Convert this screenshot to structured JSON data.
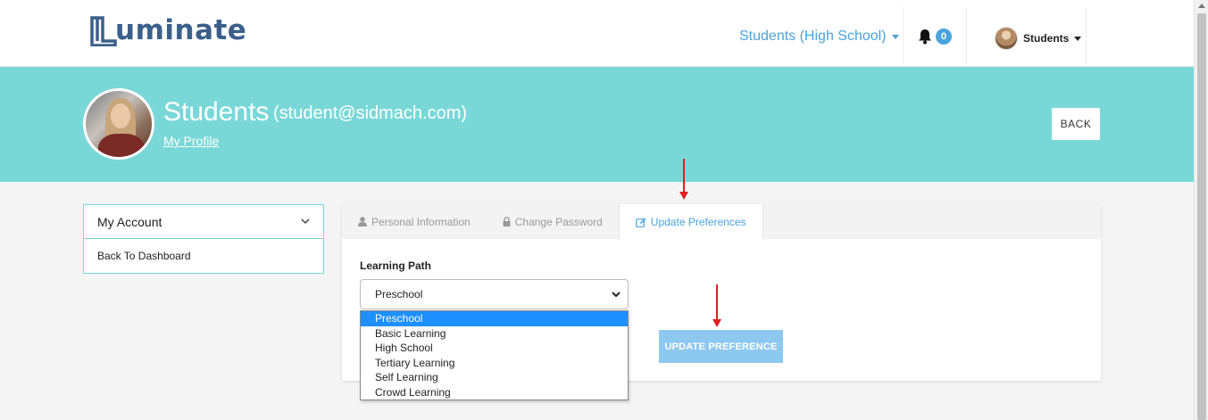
{
  "header": {
    "logo_text": "uminate",
    "role_switch": "Students (High School)",
    "notifications_count": "0",
    "user_name": "Students"
  },
  "banner": {
    "name": "Students",
    "email": "(student@sidmach.com)",
    "profile_link": "My Profile",
    "back_button": "BACK"
  },
  "sidebar": {
    "title": "My Account",
    "items": [
      {
        "label": "Back To Dashboard"
      }
    ]
  },
  "tabs": [
    {
      "label": "Personal Information",
      "icon": "user-icon",
      "active": false
    },
    {
      "label": "Change Password",
      "icon": "lock-icon",
      "active": false
    },
    {
      "label": "Update Preferences",
      "icon": "edit-icon",
      "active": true
    }
  ],
  "form": {
    "learning_path_label": "Learning Path",
    "learning_path_value": "Preschool",
    "options": [
      "Preschool",
      "Basic Learning",
      "High School",
      "Tertiary Learning",
      "Self Learning",
      "Crowd Learning"
    ],
    "submit_label": "UPDATE PREFERENCE"
  },
  "colors": {
    "banner": "#79d8d7",
    "accent": "#4aa3df",
    "logo": "#3b5f8a",
    "button": "#8dc8f0",
    "selected_option": "#1e90ff",
    "annotation_arrow": "#e02020"
  }
}
